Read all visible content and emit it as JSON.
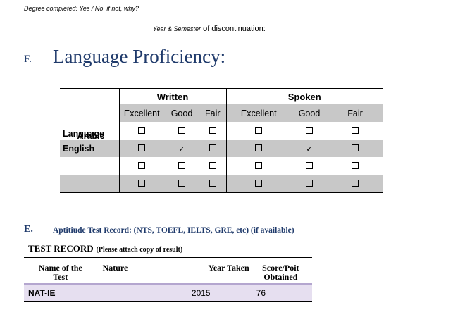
{
  "degree": {
    "label": "Degree completed: Yes / No",
    "reason": "if not, why?"
  },
  "discontinuation": {
    "small": "Year & Semester",
    "label": "of discontinuation:"
  },
  "section_f": {
    "letter": "F.",
    "title": "Language Proficiency:"
  },
  "language_table": {
    "written": "Written",
    "spoken": "Spoken",
    "language_header": "Language",
    "levels": [
      "Excellent",
      "Good",
      "Fair"
    ],
    "rows": [
      {
        "name": "Arabic",
        "written": [
          false,
          false,
          false
        ],
        "spoken": [
          false,
          false,
          false
        ]
      },
      {
        "name": "English",
        "written": [
          false,
          true,
          false
        ],
        "spoken": [
          false,
          true,
          false
        ]
      },
      {
        "name": "",
        "written": [
          false,
          false,
          false
        ],
        "spoken": [
          false,
          false,
          false
        ]
      },
      {
        "name": "",
        "written": [
          false,
          false,
          false
        ],
        "spoken": [
          false,
          false,
          false
        ]
      }
    ],
    "check_glyph": "✓"
  },
  "section_e": {
    "letter": "E.",
    "title": "Aptitiude Test Record: (NTS, TOEFL, IELTS, GRE, etc) (if available)"
  },
  "test_record": {
    "caption": "TEST RECORD",
    "note": "(Please attach copy of result)",
    "headers": {
      "name_line1": "Name of the",
      "name_line2": "Test",
      "nature": "Nature",
      "year": "Year Taken",
      "score_line1": "Score/Poit",
      "score_line2": "Obtained"
    },
    "rows": [
      {
        "name": "NAT-IE",
        "nature": "",
        "year": "2015",
        "score": "76"
      }
    ]
  }
}
